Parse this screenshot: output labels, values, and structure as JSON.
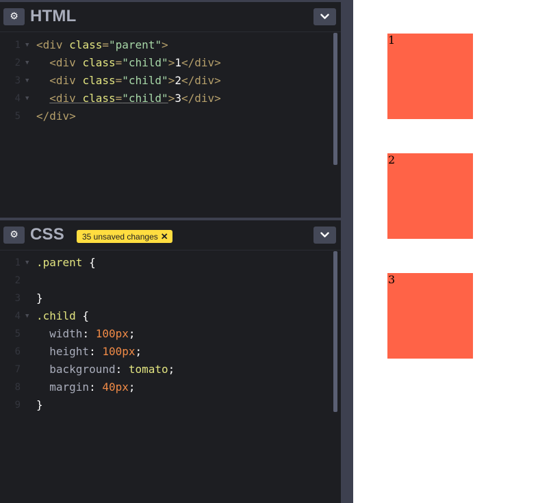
{
  "html_pane": {
    "title": "HTML",
    "lines": [
      {
        "n": "1",
        "parts": [
          [
            "tag",
            "<div "
          ],
          [
            "attr",
            "class"
          ],
          [
            "tag",
            "="
          ],
          [
            "str",
            "\"parent\""
          ],
          [
            "tag",
            ">"
          ]
        ]
      },
      {
        "n": "2",
        "parts": [
          [
            "plain",
            "  "
          ],
          [
            "tag",
            "<div "
          ],
          [
            "attr",
            "class"
          ],
          [
            "tag",
            "="
          ],
          [
            "str",
            "\"child\""
          ],
          [
            "tag",
            ">"
          ],
          [
            "plain",
            "1"
          ],
          [
            "tag",
            "</div>"
          ]
        ]
      },
      {
        "n": "3",
        "parts": [
          [
            "plain",
            "  "
          ],
          [
            "tag",
            "<div "
          ],
          [
            "attr",
            "class"
          ],
          [
            "tag",
            "="
          ],
          [
            "str",
            "\"child\""
          ],
          [
            "tag",
            ">"
          ],
          [
            "plain",
            "2"
          ],
          [
            "tag",
            "</div>"
          ]
        ]
      },
      {
        "n": "4",
        "parts": [
          [
            "plain",
            "  "
          ],
          [
            "tag",
            "<div "
          ],
          [
            "attr",
            "class"
          ],
          [
            "tag",
            "="
          ],
          [
            "str",
            "\"child\""
          ],
          [
            "tag",
            ">"
          ],
          [
            "plain",
            "3"
          ],
          [
            "tag",
            "</div>"
          ]
        ]
      },
      {
        "n": "5",
        "parts": [
          [
            "tag",
            "</div>"
          ]
        ]
      }
    ]
  },
  "css_pane": {
    "title": "CSS",
    "unsaved_badge": "35 unsaved changes",
    "lines": [
      {
        "n": "1",
        "parts": [
          [
            "sel",
            ".parent"
          ],
          [
            "plain",
            " {"
          ]
        ]
      },
      {
        "n": "2",
        "parts": []
      },
      {
        "n": "3",
        "parts": [
          [
            "plain",
            "}"
          ]
        ]
      },
      {
        "n": "4",
        "parts": [
          [
            "sel",
            ".child"
          ],
          [
            "plain",
            " {"
          ]
        ]
      },
      {
        "n": "5",
        "parts": [
          [
            "plain",
            "  "
          ],
          [
            "prop",
            "width"
          ],
          [
            "plain",
            ": "
          ],
          [
            "num",
            "100px"
          ],
          [
            "plain",
            ";"
          ]
        ]
      },
      {
        "n": "6",
        "parts": [
          [
            "plain",
            "  "
          ],
          [
            "prop",
            "height"
          ],
          [
            "plain",
            ": "
          ],
          [
            "num",
            "100px"
          ],
          [
            "plain",
            ";"
          ]
        ]
      },
      {
        "n": "7",
        "parts": [
          [
            "plain",
            "  "
          ],
          [
            "prop",
            "background"
          ],
          [
            "plain",
            ": "
          ],
          [
            "kw",
            "tomato"
          ],
          [
            "plain",
            ";"
          ]
        ]
      },
      {
        "n": "8",
        "parts": [
          [
            "plain",
            "  "
          ],
          [
            "prop",
            "margin"
          ],
          [
            "plain",
            ": "
          ],
          [
            "num",
            "40px"
          ],
          [
            "plain",
            ";"
          ]
        ]
      },
      {
        "n": "9",
        "parts": [
          [
            "plain",
            "}"
          ]
        ]
      }
    ]
  },
  "preview": {
    "children": [
      "1",
      "2",
      "3"
    ]
  },
  "colors": {
    "editor_bg": "#1d1e22",
    "divider": "#3d404f",
    "badge": "#ffdd40",
    "child_bg": "#ff6347"
  },
  "icons": {
    "settings": "gear-icon",
    "collapse": "chevron-down-icon",
    "dismiss": "close-icon"
  }
}
